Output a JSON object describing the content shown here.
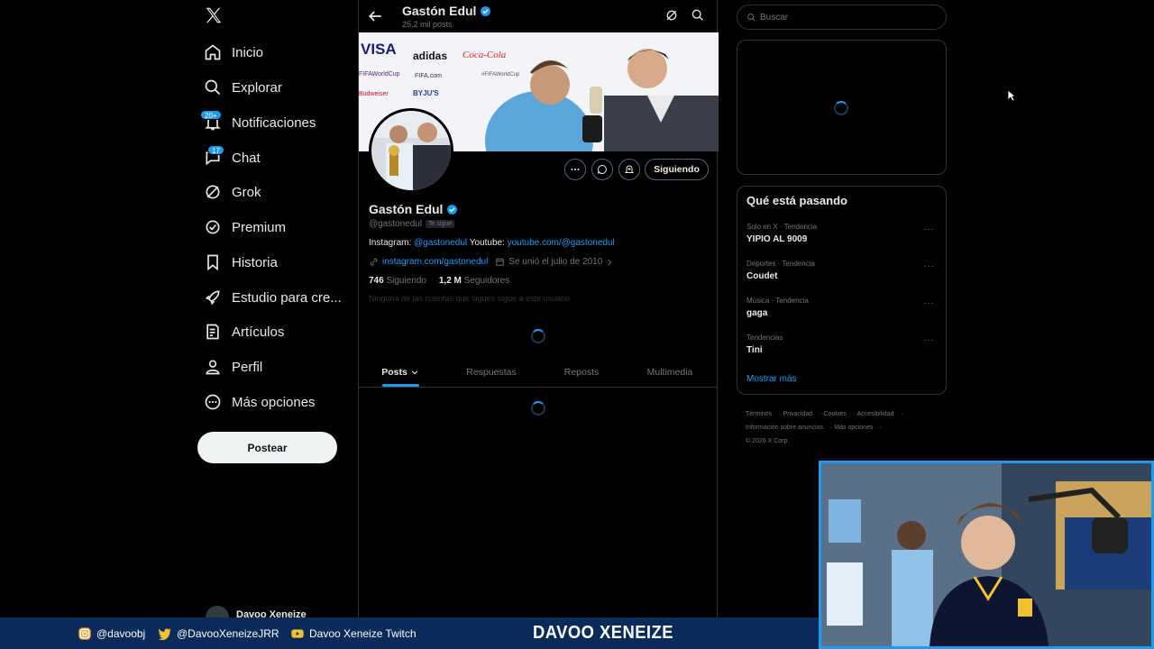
{
  "sidebar": {
    "logo": "X",
    "items": [
      {
        "label": "Inicio",
        "icon": "home-icon"
      },
      {
        "label": "Explorar",
        "icon": "search-icon"
      },
      {
        "label": "Notificaciones",
        "icon": "bell-icon",
        "badge": "20+"
      },
      {
        "label": "Chat",
        "icon": "chat-icon",
        "badge": "17"
      },
      {
        "label": "Grok",
        "icon": "grok-icon"
      },
      {
        "label": "Premium",
        "icon": "premium-icon"
      },
      {
        "label": "Historia",
        "icon": "bookmark-icon"
      },
      {
        "label": "Estudio para cre...",
        "icon": "rocket-icon"
      },
      {
        "label": "Artículos",
        "icon": "article-icon"
      },
      {
        "label": "Perfil",
        "icon": "person-icon"
      },
      {
        "label": "Más opciones",
        "icon": "more-circle-icon"
      }
    ],
    "post_label": "Postear",
    "account_name": "Davoo Xeneize"
  },
  "header": {
    "name": "Gastón Edul",
    "posts": "25,2 mil posts"
  },
  "profile": {
    "name": "Gastón Edul",
    "handle": "@gastonedul",
    "follows_you": "Te sigue",
    "follow_label": "Siguiendo",
    "bio_prefix_1": "Instagram: ",
    "bio_link_1": "@gastonedul",
    "bio_prefix_2": " Youtube: ",
    "bio_link_2": "youtube.com/@gastonedul",
    "website": "instagram.com/gastonedul",
    "joined": "Se unió el julio de 2010",
    "following_count": "746",
    "following_label": "Siguiendo",
    "followers_count": "1,2 M",
    "followers_label": "Seguidores",
    "common_followers": "Ninguna de las cuentas que sigues sigue a este usuario"
  },
  "tabs": [
    "Posts",
    "Respuestas",
    "Reposts",
    "Multimedia"
  ],
  "search": {
    "placeholder": "Buscar"
  },
  "trends": {
    "title": "Qué está pasando",
    "items": [
      {
        "meta": "Solo en X · Tendencia",
        "name": "YIPIO AL 9009"
      },
      {
        "meta": "Deportes · Tendencia",
        "name": "Coudet"
      },
      {
        "meta": "Música · Tendencia",
        "name": "gaga"
      },
      {
        "meta": "Tendencias",
        "name": "Tini"
      }
    ],
    "show_more": "Mostrar más"
  },
  "footer": {
    "links": [
      "Términos",
      "Privacidad",
      "Cookies",
      "Accesibilidad",
      "Información sobre anuncios",
      "Más opciones ···"
    ],
    "copyright": "© 2026 X Corp."
  },
  "stream": {
    "instagram": "@davoobj",
    "twitter": "@DavooXeneizeJRR",
    "twitch": "Davoo Xeneize Twitch",
    "title": "DAVOO XENEIZE"
  },
  "colors": {
    "accent": "#1d9bf0",
    "background": "#000000",
    "border": "#2f3336",
    "muted": "#71767b"
  }
}
